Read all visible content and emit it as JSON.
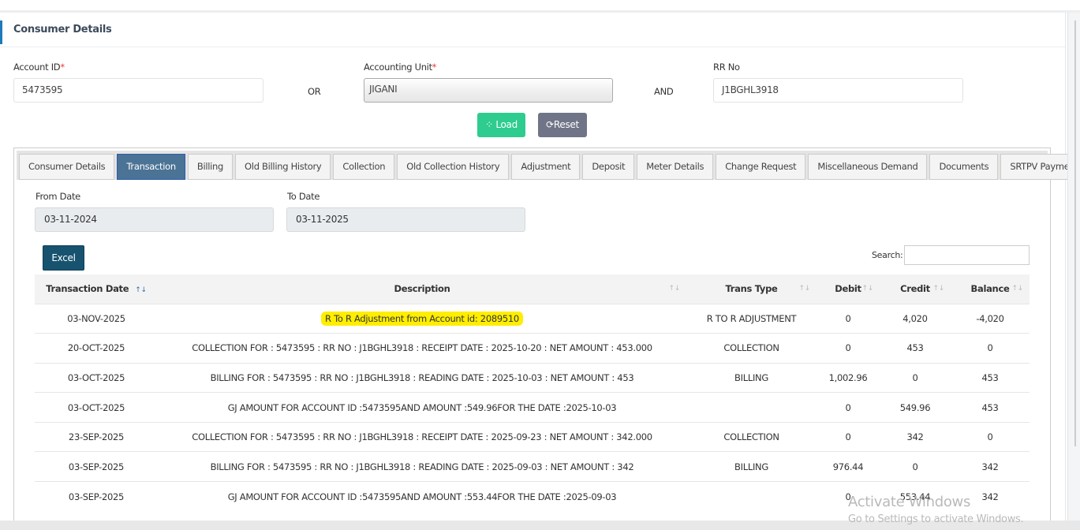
{
  "header": {
    "title": "Consumer Details"
  },
  "form": {
    "account_id_label": "Account ID",
    "account_id_value": "5473595",
    "or": "OR",
    "accounting_unit_label": "Accounting Unit",
    "accounting_unit_value": "JIGANI",
    "and": "AND",
    "rr_label": "RR No",
    "rr_value": "J1BGHL3918",
    "required": "*",
    "load": "Load",
    "reset": "Reset"
  },
  "tabs": [
    "Consumer Details",
    "Transaction",
    "Billing",
    "Old Billing History",
    "Collection",
    "Old Collection History",
    "Adjustment",
    "Deposit",
    "Meter Details",
    "Change Request",
    "Miscellaneous Demand",
    "Documents",
    "SRTPV Payment Details"
  ],
  "active_tab": "Transaction",
  "filters": {
    "from_label": "From Date",
    "from_value": "03-11-2024",
    "to_label": "To Date",
    "to_value": "03-11-2025"
  },
  "excel": "Excel",
  "search_label": "Search:",
  "table": {
    "columns": [
      "Transaction Date",
      "Description",
      "Trans Type",
      "Debit",
      "Credit",
      "Balance"
    ],
    "rows": [
      [
        "03-NOV-2025",
        "R To R Adjustment from Account id: 2089510",
        "R TO R ADJUSTMENT",
        "0",
        "4,020",
        "-4,020"
      ],
      [
        "20-OCT-2025",
        "COLLECTION FOR : 5473595 : RR NO : J1BGHL3918 : RECEIPT DATE : 2025-10-20 : NET AMOUNT : 453.000",
        "COLLECTION",
        "0",
        "453",
        "0"
      ],
      [
        "03-OCT-2025",
        "BILLING FOR : 5473595 : RR NO : J1BGHL3918 : READING DATE : 2025-10-03 : NET AMOUNT : 453",
        "BILLING",
        "1,002.96",
        "0",
        "453"
      ],
      [
        "03-OCT-2025",
        "GJ AMOUNT FOR ACCOUNT ID :5473595AND AMOUNT :549.96FOR THE DATE :2025-10-03",
        "",
        "0",
        "549.96",
        "453"
      ],
      [
        "23-SEP-2025",
        "COLLECTION FOR : 5473595 : RR NO : J1BGHL3918 : RECEIPT DATE : 2025-09-23 : NET AMOUNT : 342.000",
        "COLLECTION",
        "0",
        "342",
        "0"
      ],
      [
        "03-SEP-2025",
        "BILLING FOR : 5473595 : RR NO : J1BGHL3918 : READING DATE : 2025-09-03 : NET AMOUNT : 342",
        "BILLING",
        "976.44",
        "0",
        "342"
      ],
      [
        "03-SEP-2025",
        "GJ AMOUNT FOR ACCOUNT ID :5473595AND AMOUNT :553.44FOR THE DATE :2025-09-03",
        "",
        "0",
        "553.44",
        "342"
      ]
    ]
  },
  "watermark": {
    "line1": "Activate Windows",
    "line2": "Go to Settings to activate Windows."
  },
  "colors": {
    "accent": "#1e7ab8",
    "load": "#2ecc8f",
    "reset": "#6f7487",
    "tab_active": "#4b7395",
    "excel": "#17536f",
    "highlight": "#ffee00"
  }
}
